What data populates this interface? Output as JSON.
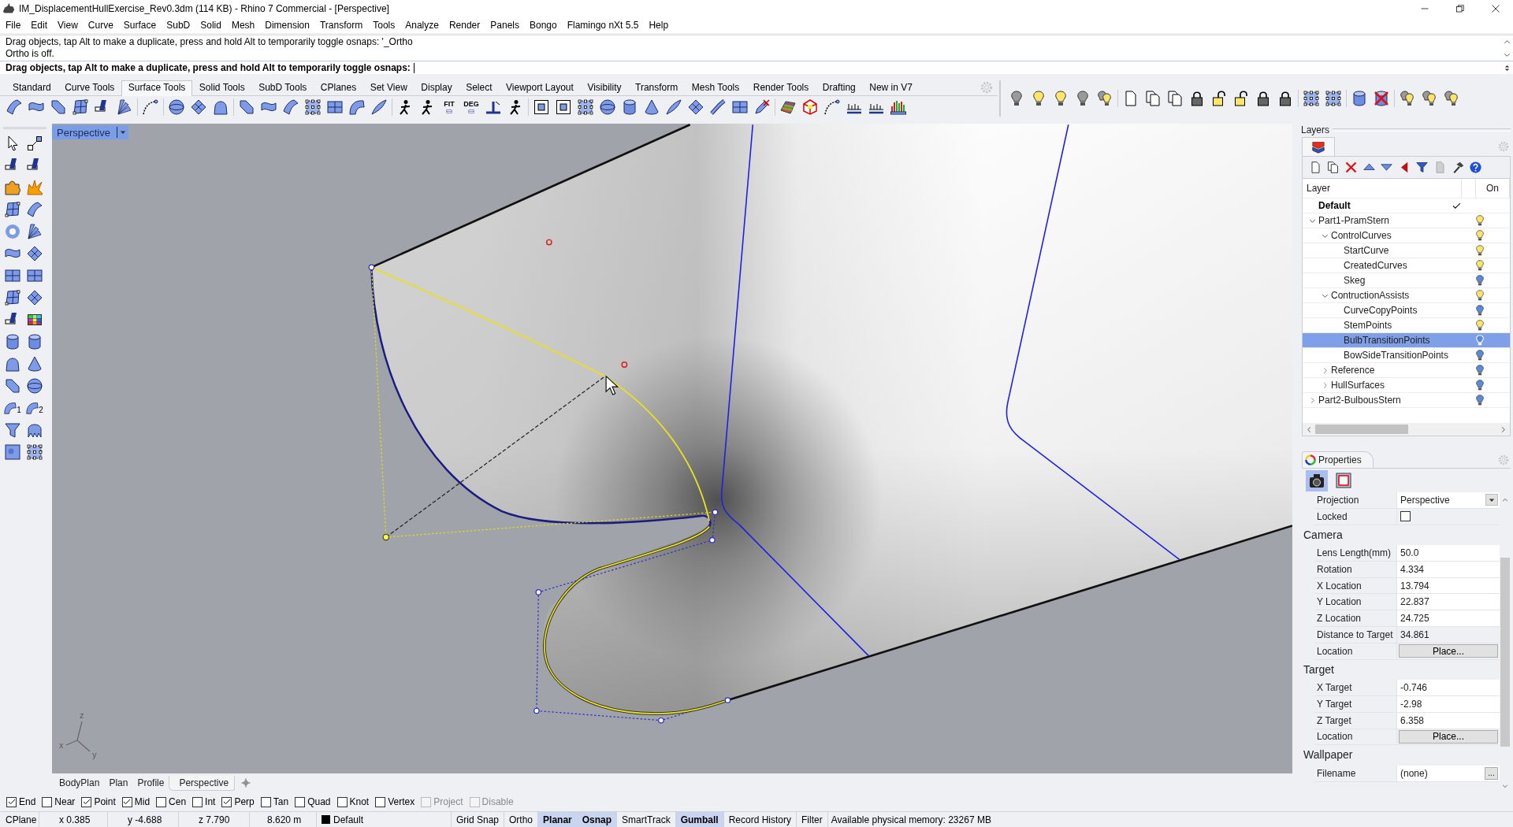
{
  "window": {
    "title": "IM_DisplacementHullExercise_Rev0.3dm (114 KB) - Rhino 7 Commercial - [Perspective]"
  },
  "menu": [
    "File",
    "Edit",
    "View",
    "Curve",
    "Surface",
    "SubD",
    "Solid",
    "Mesh",
    "Dimension",
    "Transform",
    "Tools",
    "Analyze",
    "Render",
    "Panels",
    "Bongo",
    "Flamingo nXt 5.5",
    "Help"
  ],
  "command": {
    "history": [
      "Drag objects, tap Alt to make a duplicate, press and hold Alt to temporarily toggle osnaps: '_Ortho",
      "Ortho is off."
    ],
    "prompt": "Drag objects, tap Alt to make a duplicate, press and hold Alt to temporarily toggle osnaps:"
  },
  "toolbar_tabs": [
    {
      "label": "Standard",
      "selected": false
    },
    {
      "label": "Curve Tools",
      "selected": false
    },
    {
      "label": "Surface Tools",
      "selected": true
    },
    {
      "label": "Solid Tools",
      "selected": false
    },
    {
      "label": "SubD Tools",
      "selected": false
    },
    {
      "label": "CPlanes",
      "selected": false
    },
    {
      "label": "Set View",
      "selected": false
    },
    {
      "label": "Display",
      "selected": false
    },
    {
      "label": "Select",
      "selected": false
    },
    {
      "label": "Viewport Layout",
      "selected": false
    },
    {
      "label": "Visibility",
      "selected": false
    },
    {
      "label": "Transform",
      "selected": false
    },
    {
      "label": "Mesh Tools",
      "selected": false
    },
    {
      "label": "Render Tools",
      "selected": false
    },
    {
      "label": "Drafting",
      "selected": false
    },
    {
      "label": "New in V7",
      "selected": false
    }
  ],
  "toolbar": {
    "text_buttons": [
      "FIT",
      "DEG"
    ]
  },
  "side_toolbar": {
    "numbered_buttons": [
      "1",
      "2"
    ]
  },
  "viewport": {
    "title": "Perspective",
    "axis_labels": [
      "z",
      "x",
      "y"
    ]
  },
  "viewport_tabs": [
    {
      "label": "BodyPlan",
      "selected": false
    },
    {
      "label": "Plan",
      "selected": false
    },
    {
      "label": "Profile",
      "selected": false
    },
    {
      "label": "Perspective",
      "selected": true
    }
  ],
  "layers": {
    "title": "Layers",
    "columns": [
      "Layer",
      "On"
    ],
    "items": [
      {
        "name": "Default",
        "current": true,
        "selected": false
      },
      {
        "name": "Part1-PramStern",
        "current": false,
        "selected": false,
        "on": true,
        "expanded": true,
        "children": [
          {
            "name": "ControlCurves",
            "current": false,
            "selected": false,
            "on": true,
            "expanded": true,
            "children": [
              {
                "name": "StartCurve",
                "current": false,
                "selected": false,
                "on": true
              },
              {
                "name": "CreatedCurves",
                "current": false,
                "selected": false,
                "on": true
              },
              {
                "name": "Skeg",
                "current": false,
                "selected": false,
                "on": false
              }
            ]
          },
          {
            "name": "ContructionAssists",
            "current": false,
            "selected": false,
            "on": true,
            "expanded": true,
            "children": [
              {
                "name": "CurveCopyPoints",
                "current": false,
                "selected": false,
                "on": false
              },
              {
                "name": "StemPoints",
                "current": false,
                "selected": false,
                "on": true
              },
              {
                "name": "BulbTransitionPoints",
                "current": false,
                "selected": true,
                "on": false
              },
              {
                "name": "BowSideTransitionPoints",
                "current": false,
                "selected": false,
                "on": false
              }
            ]
          },
          {
            "name": "Reference",
            "current": false,
            "selected": false,
            "on": false,
            "expanded": false
          },
          {
            "name": "HullSurfaces",
            "current": false,
            "selected": false,
            "on": false,
            "expanded": false
          }
        ]
      },
      {
        "name": "Part2-BulbousStern",
        "current": false,
        "selected": false,
        "on": false,
        "expanded": false
      }
    ]
  },
  "properties": {
    "title": "Properties",
    "tabs": [
      {
        "selected": true
      },
      {
        "selected": false
      }
    ],
    "rows": [
      {
        "kind": "dropdown",
        "label": "Projection",
        "value": "Perspective"
      },
      {
        "kind": "checkbox",
        "label": "Locked",
        "checked": false
      }
    ],
    "sections": [
      {
        "title": "Camera",
        "rows": [
          {
            "kind": "input",
            "label": "Lens Length(mm)",
            "value": "50.0"
          },
          {
            "kind": "input",
            "label": "Rotation",
            "value": "4.334"
          },
          {
            "kind": "input",
            "label": "X Location",
            "value": "13.794"
          },
          {
            "kind": "input",
            "label": "Y Location",
            "value": "22.837"
          },
          {
            "kind": "input",
            "label": "Z Location",
            "value": "24.725"
          },
          {
            "kind": "text",
            "label": "Distance to Target",
            "value": "34.861"
          },
          {
            "kind": "button",
            "label": "Location",
            "value": "Place..."
          }
        ]
      },
      {
        "title": "Target",
        "rows": [
          {
            "kind": "input",
            "label": "X Target",
            "value": "-0.746"
          },
          {
            "kind": "input",
            "label": "Y Target",
            "value": "-2.98"
          },
          {
            "kind": "input",
            "label": "Z Target",
            "value": "6.358"
          },
          {
            "kind": "button",
            "label": "Location",
            "value": "Place..."
          }
        ]
      },
      {
        "title": "Wallpaper",
        "rows": [
          {
            "kind": "file",
            "label": "Filename",
            "value": "(none)",
            "button": "..."
          }
        ]
      }
    ]
  },
  "osnaps": [
    {
      "label": "End",
      "checked": true,
      "disabled": false
    },
    {
      "label": "Near",
      "checked": false,
      "disabled": false
    },
    {
      "label": "Point",
      "checked": true,
      "disabled": false
    },
    {
      "label": "Mid",
      "checked": true,
      "disabled": false
    },
    {
      "label": "Cen",
      "checked": false,
      "disabled": false
    },
    {
      "label": "Int",
      "checked": false,
      "disabled": false
    },
    {
      "label": "Perp",
      "checked": true,
      "disabled": false
    },
    {
      "label": "Tan",
      "checked": false,
      "disabled": false
    },
    {
      "label": "Quad",
      "checked": false,
      "disabled": false
    },
    {
      "label": "Knot",
      "checked": false,
      "disabled": false
    },
    {
      "label": "Vertex",
      "checked": false,
      "disabled": false
    },
    {
      "label": "Project",
      "checked": false,
      "disabled": true
    },
    {
      "label": "Disable",
      "checked": false,
      "disabled": true
    }
  ],
  "status_bar": {
    "cplane": "CPlane",
    "x": "x 0.385",
    "y": "y -4.688",
    "z": "z 7.790",
    "distance": "8.620 m",
    "layer": "Default",
    "toggles": [
      {
        "label": "Grid Snap",
        "on": false
      },
      {
        "label": "Ortho",
        "on": false
      },
      {
        "label": "Planar",
        "on": true
      },
      {
        "label": "Osnap",
        "on": true
      },
      {
        "label": "SmartTrack",
        "on": false
      },
      {
        "label": "Gumball",
        "on": true
      },
      {
        "label": "Record History",
        "on": false
      },
      {
        "label": "Filter",
        "on": false
      }
    ],
    "memory": "Available physical memory: 23267 MB"
  }
}
